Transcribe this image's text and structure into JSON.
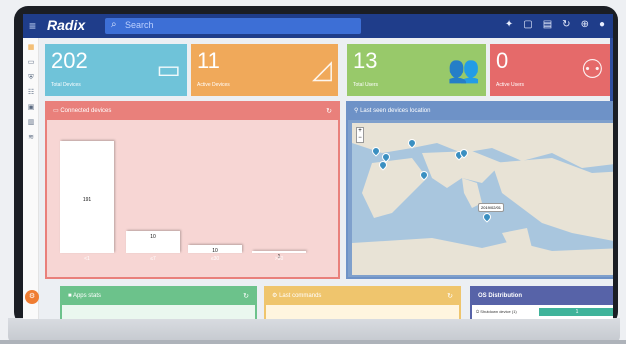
{
  "app": {
    "brand": "Radix"
  },
  "search": {
    "placeholder": "Search"
  },
  "stats": [
    {
      "value": "202",
      "label": "Total Devices",
      "icon": "devices-icon"
    },
    {
      "value": "11",
      "label": "Active Devices",
      "icon": "cast-icon"
    },
    {
      "value": "13",
      "label": "Total Users",
      "icon": "users-icon"
    },
    {
      "value": "0",
      "label": "Active Users",
      "icon": "user-group-icon"
    }
  ],
  "connected_devices": {
    "title": "Connected devices",
    "chart_data": {
      "type": "bar",
      "categories": [
        "<1",
        "≤7",
        "≤30",
        ">30"
      ],
      "values": [
        191,
        10,
        10,
        1
      ]
    }
  },
  "map": {
    "title": "Last seen devices location",
    "tooltip": "2019/02/01",
    "zoom_in": "+",
    "zoom_out": "−"
  },
  "apps_stats": {
    "title": "Apps stats"
  },
  "last_commands": {
    "title": "Last commands"
  },
  "os_distribution": {
    "title": "OS Distribution",
    "row_label": "Shutdown device (1)",
    "row_value": "1"
  },
  "fab_label": "⚙"
}
